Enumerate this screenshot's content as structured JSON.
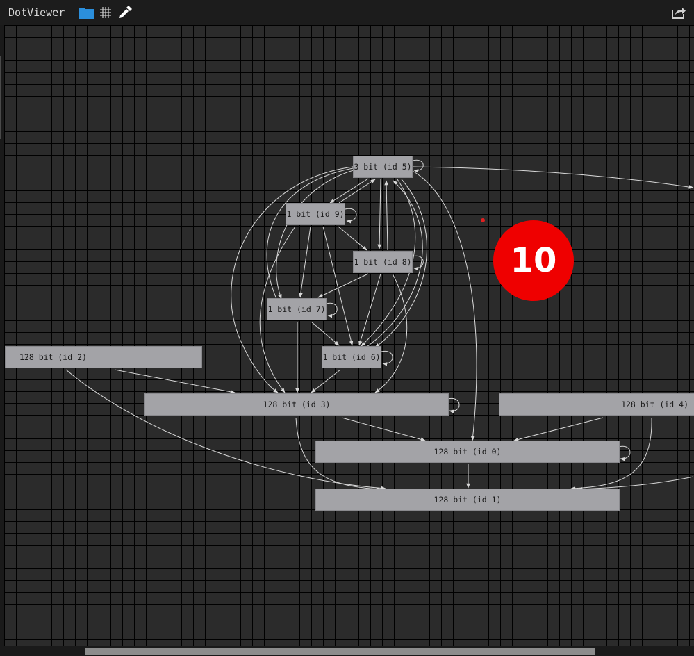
{
  "toolbar": {
    "title": "DotViewer",
    "open_icon": "folder-icon",
    "grid_icon": "grid-icon",
    "picker_icon": "eyedropper-icon",
    "share_icon": "share-icon"
  },
  "graph": {
    "nodes": {
      "n5": "3 bit (id 5)",
      "n9": "1 bit (id 9)",
      "n8": "1 bit (id 8)",
      "n7": "1 bit (id 7)",
      "n6": "1 bit (id 6)",
      "n2": "128 bit (id 2)",
      "n3": "128 bit (id 3)",
      "n4": "128 bit (id 4)",
      "n0": "128 bit (id 0)",
      "n1": "128 bit (id 1)"
    }
  },
  "badge": {
    "step": "10"
  },
  "colors": {
    "background": "#2b2b2b",
    "grid": "#000000",
    "node_fill": "#a3a3a7",
    "edge": "#d8d8d8",
    "badge": "#ef0000"
  }
}
